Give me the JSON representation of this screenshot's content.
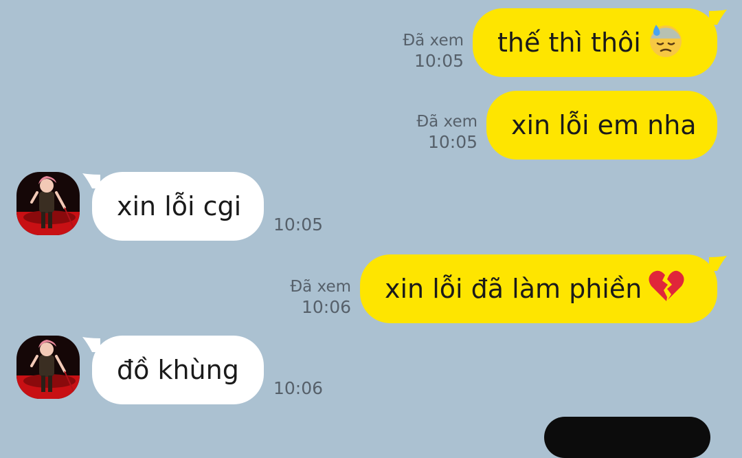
{
  "chat": {
    "messages": [
      {
        "direction": "out",
        "text": "thế thì thôi",
        "emoji": "downcast-sweat-emoji",
        "read": "Đã xem",
        "time": "10:05"
      },
      {
        "direction": "out",
        "text": "xin lỗi em nha",
        "read": "Đã xem",
        "time": "10:05"
      },
      {
        "direction": "in",
        "text": "xin lỗi cgi",
        "time": "10:05"
      },
      {
        "direction": "out",
        "text": "xin lỗi đã làm phiền",
        "emoji": "broken-heart-emoji",
        "read": "Đã xem",
        "time": "10:06"
      },
      {
        "direction": "in",
        "text": "đồ khùng",
        "time": "10:06"
      }
    ]
  },
  "colors": {
    "background": "#abc1d1",
    "outgoing_bubble": "#fee500",
    "incoming_bubble": "#ffffff",
    "meta_text": "#56606a"
  }
}
